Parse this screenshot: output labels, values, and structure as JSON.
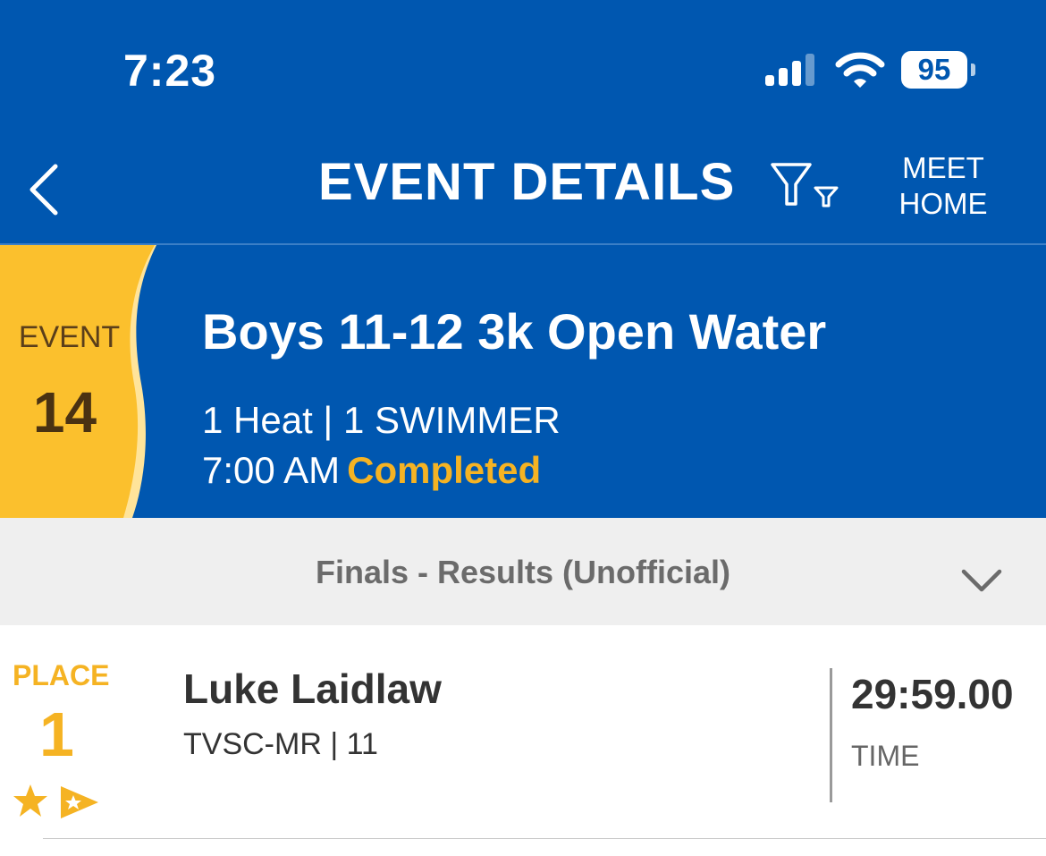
{
  "status_bar": {
    "time": "7:23",
    "battery": "95",
    "icons": [
      "signal-icon",
      "wifi-icon",
      "battery-icon"
    ]
  },
  "nav": {
    "back_icon": "chevron-left-icon",
    "title": "EVENT DETAILS",
    "filter_icon": "filter-icon",
    "meet_home_line1": "MEET",
    "meet_home_line2": "HOME"
  },
  "event": {
    "label": "EVENT",
    "number": "14",
    "title": "Boys 11-12 3k Open Water",
    "heat_info": "1 Heat | 1 SWIMMER",
    "time": "7:00 AM",
    "status": "Completed"
  },
  "results": {
    "title": "Finals - Results (Unofficial)",
    "dropdown_icon": "chevron-down-icon"
  },
  "swimmers": [
    {
      "place_label": "PLACE",
      "place": "1",
      "name": "Luke Laidlaw",
      "meta": "TVSC-MR | 11",
      "time": "29:59.00",
      "time_label": "TIME",
      "badges": [
        "star-icon",
        "flag-icon"
      ]
    }
  ],
  "colors": {
    "primary": "#0057B0",
    "accent": "#F5B323",
    "bar_bg": "#EFEFEF"
  }
}
